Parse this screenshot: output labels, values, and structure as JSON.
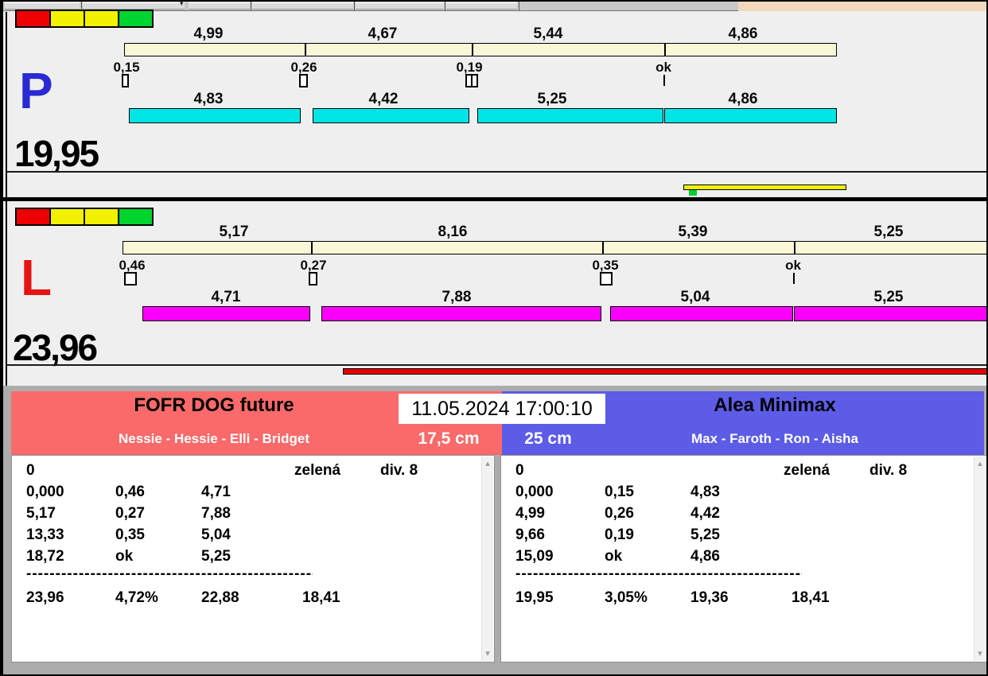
{
  "toolbar": {
    "dropdown_glyph": "▾"
  },
  "status_lights": {
    "colors": [
      "#EE0000",
      "#F2F200",
      "#F2F200",
      "#00D42E"
    ]
  },
  "panels": {
    "p": {
      "letter": "P",
      "letter_color": "#2A2AD4",
      "total": "19,95",
      "bar_color": "#00E6E6",
      "tip_times": [
        "4,99",
        "4,67",
        "5,44",
        "4,86"
      ],
      "changes": [
        "0,15",
        "0,26",
        "0,19",
        "ok"
      ],
      "run_times": [
        "4,83",
        "4,42",
        "5,25",
        "4,86"
      ]
    },
    "l": {
      "letter": "L",
      "letter_color": "#E41414",
      "total": "23,96",
      "bar_color": "#FA00FA",
      "tip_times": [
        "5,17",
        "8,16",
        "5,39",
        "5,25"
      ],
      "changes": [
        "0,46",
        "0,27",
        "0,35",
        "ok"
      ],
      "run_times": [
        "4,71",
        "7,88",
        "5,04",
        "5,25"
      ]
    }
  },
  "indicators": {
    "yellow_bar_color": "#F2F200",
    "green_mark_color": "#00CC33",
    "red_bar_color": "#E60000"
  },
  "bottom": {
    "datetime": "11.05.2024 17:00:10",
    "scrollbar": {
      "up_glyph": "▴",
      "down_glyph": "▾"
    },
    "left_team": {
      "name": "FOFR DOG future",
      "dogs": "Nessie - Hessie - Elli - Bridget",
      "height": "17,5 cm",
      "header_color": "#FA6A6A",
      "table": {
        "start": "0",
        "color_note": "zelená",
        "division": "div. 8",
        "rows": [
          [
            "0,000",
            "0,46",
            "4,71"
          ],
          [
            "5,17",
            "0,27",
            "7,88"
          ],
          [
            "13,33",
            "0,35",
            "5,04"
          ],
          [
            "18,72",
            "ok",
            "5,25"
          ]
        ],
        "separator": "--------------------------------------------------",
        "totals": [
          "23,96",
          "4,72%",
          "22,88",
          "18,41"
        ]
      }
    },
    "right_team": {
      "name": "Alea Minimax",
      "dogs": "Max - Faroth - Ron - Aisha",
      "height": "25 cm",
      "header_color": "#5C5CE6",
      "table": {
        "start": "0",
        "color_note": "zelená",
        "division": "div. 8",
        "rows": [
          [
            "0,000",
            "0,15",
            "4,83"
          ],
          [
            "4,99",
            "0,26",
            "4,42"
          ],
          [
            "9,66",
            "0,19",
            "5,25"
          ],
          [
            "15,09",
            "ok",
            "4,86"
          ]
        ],
        "separator": "--------------------------------------------------",
        "totals": [
          "19,95",
          "3,05%",
          "19,36",
          "18,41"
        ]
      }
    }
  }
}
